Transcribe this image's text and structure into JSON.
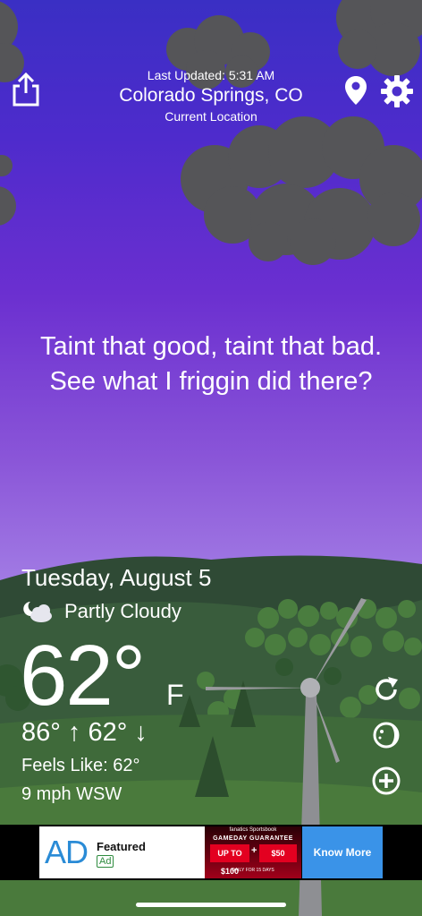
{
  "header": {
    "last_updated": "Last Updated: 5:31 AM",
    "city": "Colorado Springs, CO",
    "location_label": "Current Location",
    "icons": [
      "share-icon",
      "location-pin-icon",
      "gear-icon"
    ]
  },
  "quote": "Taint that good, taint that bad. See what I friggin did there?",
  "weather": {
    "date": "Tuesday, August 5",
    "condition": "Partly Cloudy",
    "condition_icon": "partly-cloudy-night-icon",
    "temperature": "62°",
    "unit": "F",
    "hi_lo": "86° ↑ 62° ↓",
    "feels_like": "Feels Like: 62°",
    "wind": "9 mph WSW"
  },
  "side_buttons": [
    "refresh-icon",
    "moon-phase-icon",
    "add-icon"
  ],
  "ad": {
    "logo": "AD",
    "title": "Featured",
    "badge": "Ad",
    "image_top": "fanatics Sportsbook",
    "image_title": "GAMEDAY GUARANTEE",
    "offer_1": "UP TO $100",
    "offer_2": "$50",
    "image_foot": "DAILY FOR 15 DAYS",
    "button": "Know More"
  }
}
